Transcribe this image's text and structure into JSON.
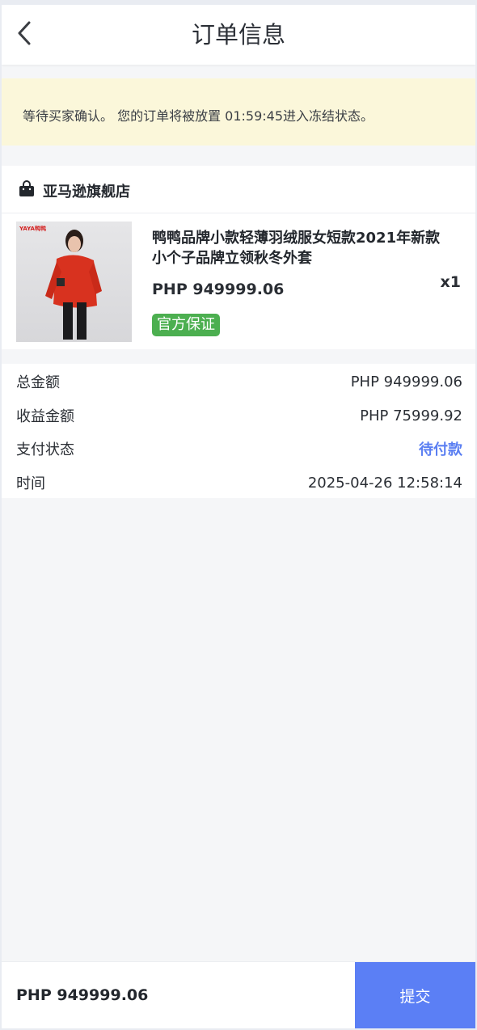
{
  "header": {
    "title": "订单信息",
    "back_icon": "chevron-left-icon"
  },
  "notice": {
    "text": "等待买家确认。 您的订单将被放置 01:59:45进入冻结状态。",
    "bg_color": "#fbf7da"
  },
  "store": {
    "icon": "shopping-bag-icon",
    "name": "亚马逊旗舰店"
  },
  "product": {
    "thumb_brand": "YAYA鸭鸭",
    "name": "鸭鸭品牌小款轻薄羽绒服女短款2021年新款小个子品牌立领秋冬外套",
    "price": "PHP 949999.06",
    "quantity": "x1",
    "badge": "官方保证",
    "badge_color": "#4caf50"
  },
  "summary": {
    "rows": [
      {
        "label": "总金额",
        "value": "PHP 949999.06"
      },
      {
        "label": "收益金额",
        "value": "PHP 75999.92"
      },
      {
        "label": "支付状态",
        "value": "待付款"
      },
      {
        "label": "时间",
        "value": "2025-04-26 12:58:14"
      }
    ],
    "status_color": "#5b7ff2"
  },
  "footer": {
    "total": "PHP 949999.06",
    "submit_label": "提交",
    "accent_color": "#5b7ff5"
  }
}
